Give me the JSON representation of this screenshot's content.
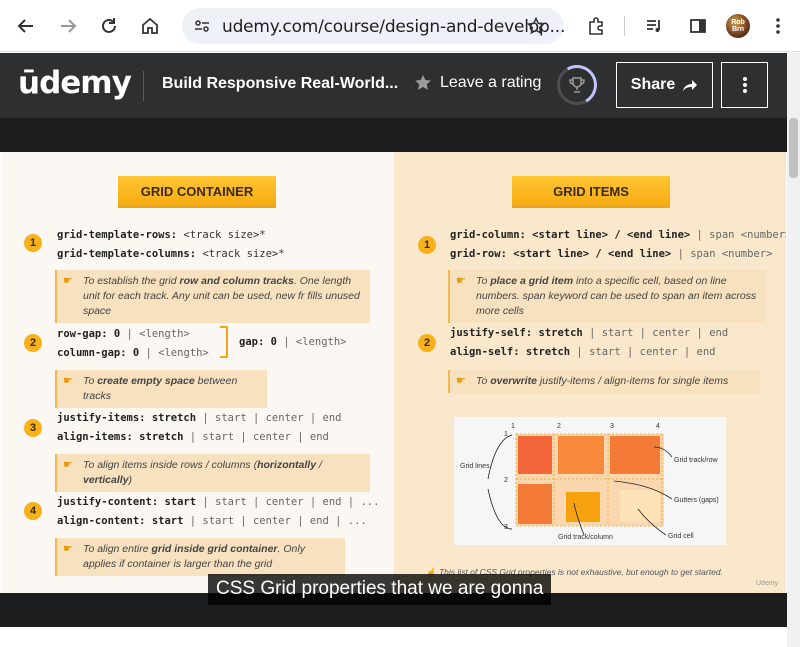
{
  "browser": {
    "url": "udemy.com/course/design-and-develop..."
  },
  "header": {
    "logo": "ūdemy",
    "course_title": "Build Responsive Real-World...",
    "rating_label": "Leave a rating",
    "share_label": "Share"
  },
  "slide": {
    "left": {
      "title": "GRID CONTAINER",
      "items": [
        {
          "num": "1",
          "line1_key": "grid-template-rows:",
          "line1_val": " <track size>*",
          "line2_key": "grid-template-columns:",
          "line2_val": " <track size>*",
          "note_pre": "To establish the grid ",
          "note_bold": "row and column tracks",
          "note_post": ". One length unit for each track. Any unit can be used, new fr fills unused space"
        },
        {
          "num": "2",
          "line1_key": "row-gap: 0",
          "line1_val": " | <length>",
          "line2_key": "column-gap: 0",
          "line2_val": " | <length>",
          "gap_key": "gap: 0",
          "gap_val": " | <length>",
          "note_pre": "To ",
          "note_bold": "create empty space",
          "note_post": " between tracks"
        },
        {
          "num": "3",
          "line1_key": "justify-items: stretch",
          "line1_val": " | start | center | end",
          "line2_key": "align-items: stretch",
          "line2_val": " | start | center | end",
          "note_pre": "To align items inside rows / columns (",
          "note_bold": "horizontally",
          "note_mid": " / ",
          "note_bold2": "vertically",
          "note_post": ")"
        },
        {
          "num": "4",
          "line1_key": "justify-content: start",
          "line1_val": " | start | center | end | ...",
          "line2_key": "align-content: start",
          "line2_val": " | start | center | end | ...",
          "note_pre": "To align entire ",
          "note_bold": "grid inside grid container",
          "note_post": ". Only applies if container is larger than the grid"
        }
      ]
    },
    "right": {
      "title": "GRID ITEMS",
      "items": [
        {
          "num": "1",
          "line1_key": "grid-column: <start line> / <end line>",
          "line1_val": " | span <number>",
          "line2_key": "grid-row: <start line> / <end line>",
          "line2_val": " | span <number>",
          "note_pre": "To ",
          "note_bold": "place a grid item",
          "note_post": " into a specific cell, based on line numbers. span keyword can be used to span an item across more cells"
        },
        {
          "num": "2",
          "line1_key": "justify-self: stretch",
          "line1_val": " | start | center | end",
          "line2_key": "align-self: stretch",
          "line2_val": " | start | center | end",
          "note_pre": "To ",
          "note_bold": "overwrite",
          "note_post": " justify-items / align-items for single items"
        }
      ],
      "diagram": {
        "line_numbers_top": [
          "1",
          "2",
          "3",
          "4"
        ],
        "line_numbers_left": [
          "1",
          "2",
          "3"
        ],
        "labels": {
          "grid_lines": "Grid lines",
          "track_row": "Grid track/row",
          "gutters": "Gutters (gaps)",
          "track_column": "Grid track/column",
          "cell": "Grid cell"
        }
      },
      "footnote": "This list of CSS Grid properties is not exhaustive, but enough to get started.",
      "watermark": "Udemy"
    }
  },
  "caption": "CSS Grid properties that we are gonna",
  "colors": {
    "accent_yellow": "#f7b21b",
    "udemy_purple": "#a435f0",
    "header_bg": "#2d2f31"
  }
}
